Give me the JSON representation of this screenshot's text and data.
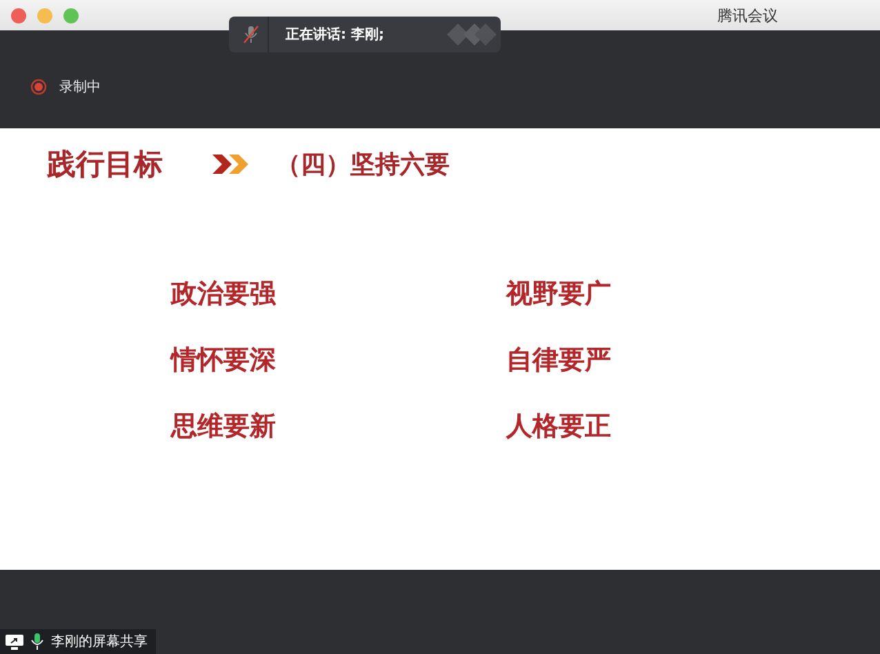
{
  "window": {
    "title": "腾讯会议"
  },
  "speaking": {
    "label": "正在讲话: 李刚;"
  },
  "recording": {
    "label": "录制中",
    "on": true
  },
  "slide": {
    "section": "践行目标",
    "heading": "（四）坚持六要",
    "items": [
      "政治要强",
      "视野要广",
      "情怀要深",
      "自律要严",
      "思维要新",
      "人格要正"
    ]
  },
  "share_label": "李刚的屏幕共享"
}
